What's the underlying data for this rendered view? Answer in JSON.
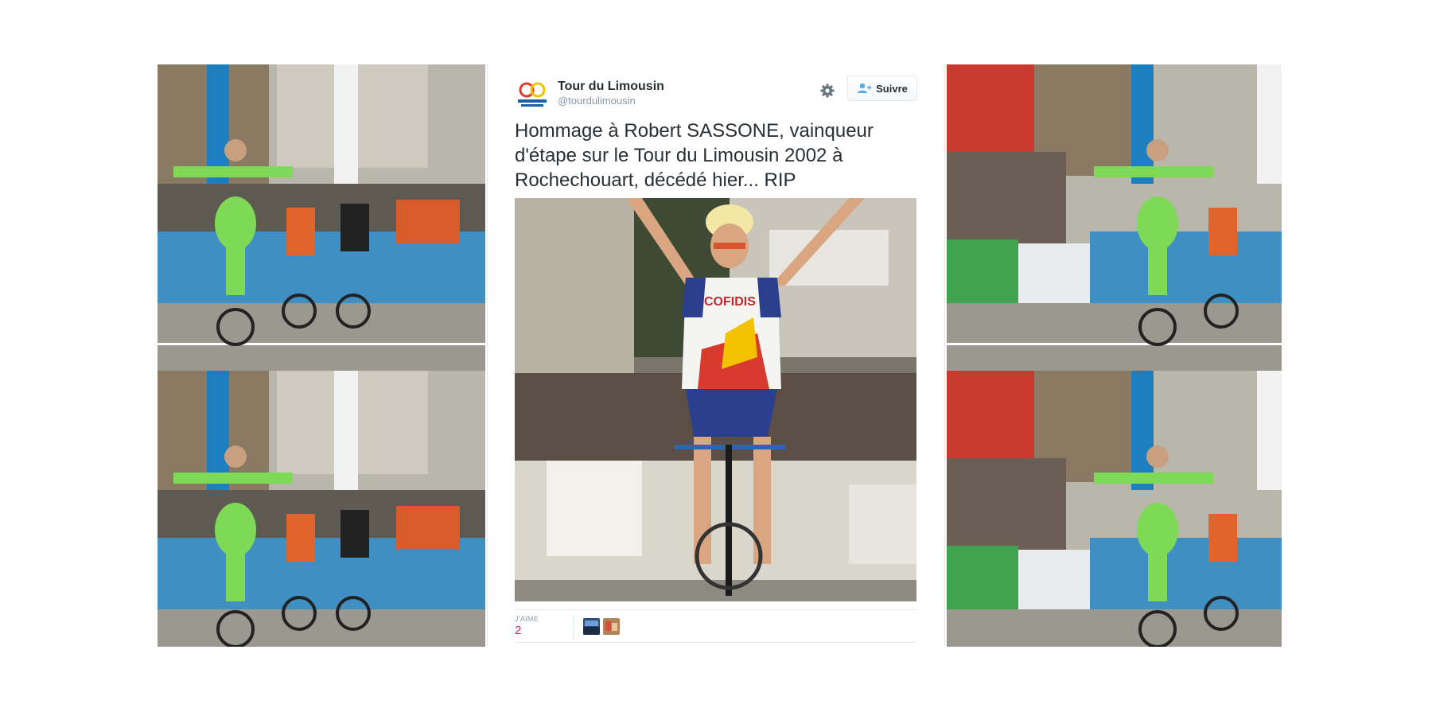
{
  "tweet": {
    "author_name": "Tour du Limousin",
    "author_handle": "@tourdulimousin",
    "follow_label": "Suivre",
    "text": "Hommage à Robert SASSONE, vainqueur d'étape sur le Tour du Limousin 2002 à Rochechouart, décédé hier... RIP",
    "likes_label": "J'AIME",
    "likes_count": "2"
  },
  "icons": {
    "avatar": "tour-du-limousin-logo-icon",
    "settings": "gear-icon",
    "follow": "add-user-icon"
  },
  "colors": {
    "name_text": "#292f33",
    "handle_text": "#8899a6",
    "likes_count": "#e0245e",
    "border": "#e1e8ed"
  }
}
